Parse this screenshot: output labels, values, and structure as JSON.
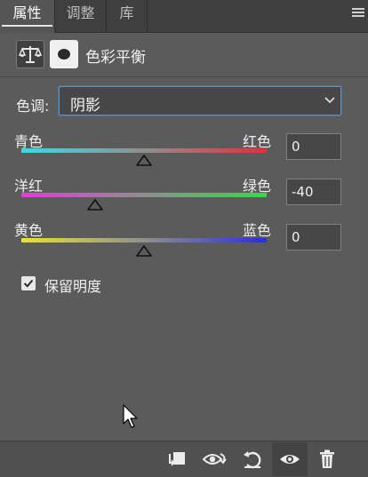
{
  "tabs": [
    {
      "label": "属性",
      "active": true
    },
    {
      "label": "调整",
      "active": false
    },
    {
      "label": "库",
      "active": false
    }
  ],
  "header": {
    "title": "色彩平衡",
    "icon": "color-balance-icon",
    "mask_icon": "layer-mask-icon"
  },
  "tone": {
    "label": "色调:",
    "value": "阴影"
  },
  "sliders": [
    {
      "left_label": "青色",
      "right_label": "红色",
      "value": "0",
      "level": 0,
      "gradient": [
        "#3fd9e6",
        "#e0303c"
      ]
    },
    {
      "left_label": "洋红",
      "right_label": "绿色",
      "value": "-40",
      "level": -40,
      "gradient": [
        "#e03cd8",
        "#39d64a"
      ]
    },
    {
      "left_label": "黄色",
      "right_label": "蓝色",
      "value": "0",
      "level": 0,
      "gradient": [
        "#e8e23a",
        "#2a2fd8"
      ]
    }
  ],
  "preserve_luminosity": {
    "label": "保留明度",
    "checked": true
  },
  "toolbar": {
    "icons": [
      "clip-to-layer-icon",
      "view-previous-state-icon",
      "reset-icon",
      "visibility-eye-icon",
      "delete-icon"
    ]
  }
}
